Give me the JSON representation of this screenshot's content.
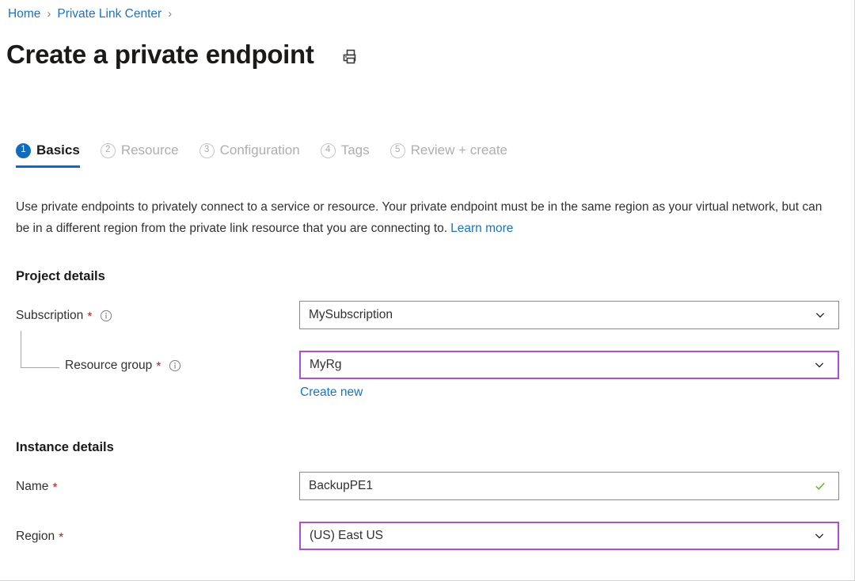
{
  "breadcrumb": {
    "items": [
      {
        "label": "Home"
      },
      {
        "label": "Private Link Center"
      }
    ],
    "separator": "›"
  },
  "header": {
    "title": "Create a private endpoint",
    "print_icon": "printer-icon"
  },
  "tabs": [
    {
      "num": "1",
      "label": "Basics",
      "active": true
    },
    {
      "num": "2",
      "label": "Resource",
      "active": false
    },
    {
      "num": "3",
      "label": "Configuration",
      "active": false
    },
    {
      "num": "4",
      "label": "Tags",
      "active": false
    },
    {
      "num": "5",
      "label": "Review + create",
      "active": false
    }
  ],
  "description": {
    "text": "Use private endpoints to privately connect to a service or resource. Your private endpoint must be in the same region as your virtual network, but can be in a different region from the private link resource that you are connecting to.",
    "link_label": "Learn more"
  },
  "sections": {
    "project": {
      "heading": "Project details",
      "fields": {
        "subscription": {
          "label": "Subscription",
          "required": "*",
          "info_icon": "info-icon",
          "value": "MySubscription",
          "trailing_icon": "chevron-down-icon",
          "border": "#8a8886"
        },
        "resource_group": {
          "label": "Resource group",
          "required": "*",
          "info_icon": "info-icon",
          "value": "MyRg",
          "trailing_icon": "chevron-down-icon",
          "border": "#b14fce",
          "create_new_label": "Create new"
        }
      }
    },
    "instance": {
      "heading": "Instance details",
      "fields": {
        "name": {
          "label": "Name",
          "required": "*",
          "value": "BackupPE1",
          "trailing_icon": "checkmark-icon",
          "border": "#8a8886"
        },
        "region": {
          "label": "Region",
          "required": "*",
          "value": "(US) East US",
          "trailing_icon": "chevron-down-icon",
          "border": "#b14fce"
        }
      }
    }
  },
  "colors": {
    "link_blue": "#1a73c7",
    "accent_blue": "#0f6cbd",
    "required_red": "#a4262c",
    "focus_purple": "#b14fce",
    "valid_green": "#5fb526"
  }
}
